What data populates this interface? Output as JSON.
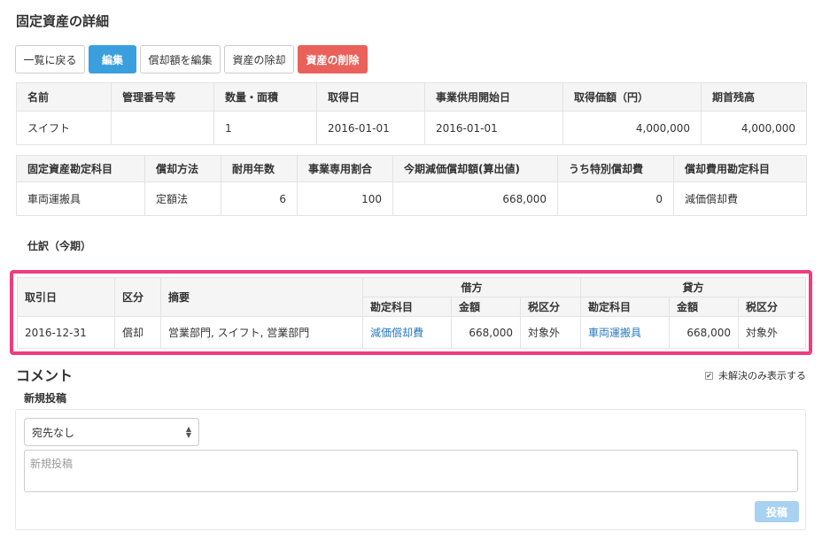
{
  "page": {
    "title": "固定資産の詳細"
  },
  "toolbar": {
    "back_label": "一覧に戻る",
    "edit_label": "編集",
    "edit_depreciation_label": "償却額を編集",
    "removal_label": "資産の除却",
    "delete_label": "資産の削除"
  },
  "asset_table": {
    "headers": [
      "名前",
      "管理番号等",
      "数量・面積",
      "取得日",
      "事業供用開始日",
      "取得価額（円）",
      "期首残高"
    ],
    "row": [
      "スイフト",
      "",
      "1",
      "2016-01-01",
      "2016-01-01",
      "4,000,000",
      "4,000,000"
    ]
  },
  "account_table": {
    "headers": [
      "固定資産勘定科目",
      "償却方法",
      "耐用年数",
      "事業専用割合",
      "今期減価償却額(算出値)",
      "うち特別償却費",
      "償却費用勘定科目"
    ],
    "row": [
      "車両運搬具",
      "定額法",
      "6",
      "100",
      "668,000",
      "0",
      "減価償却費"
    ]
  },
  "journal": {
    "section_label": "仕訳（今期）",
    "headers": {
      "date": "取引日",
      "category": "区分",
      "description": "摘要",
      "debit": "借方",
      "credit": "貸方",
      "account": "勘定科目",
      "amount": "金額",
      "tax": "税区分"
    },
    "row": {
      "date": "2016-12-31",
      "category": "償却",
      "description": "営業部門, スイフト, 営業部門",
      "debit_account": "減価償却費",
      "debit_amount": "668,000",
      "debit_tax": "対象外",
      "credit_account": "車両運搬具",
      "credit_amount": "668,000",
      "credit_tax": "対象外"
    }
  },
  "comments": {
    "title": "コメント",
    "unresolved_label": "未解決のみ表示する",
    "unresolved_checked": true,
    "new_post_label": "新規投稿",
    "recipient_selected": "宛先なし",
    "textarea_placeholder": "新規投稿",
    "submit_label": "投稿"
  },
  "colors": {
    "primary": "#3a9fdc",
    "danger": "#e9615a",
    "highlight": "#f03c7d",
    "link": "#2a7ac2"
  }
}
